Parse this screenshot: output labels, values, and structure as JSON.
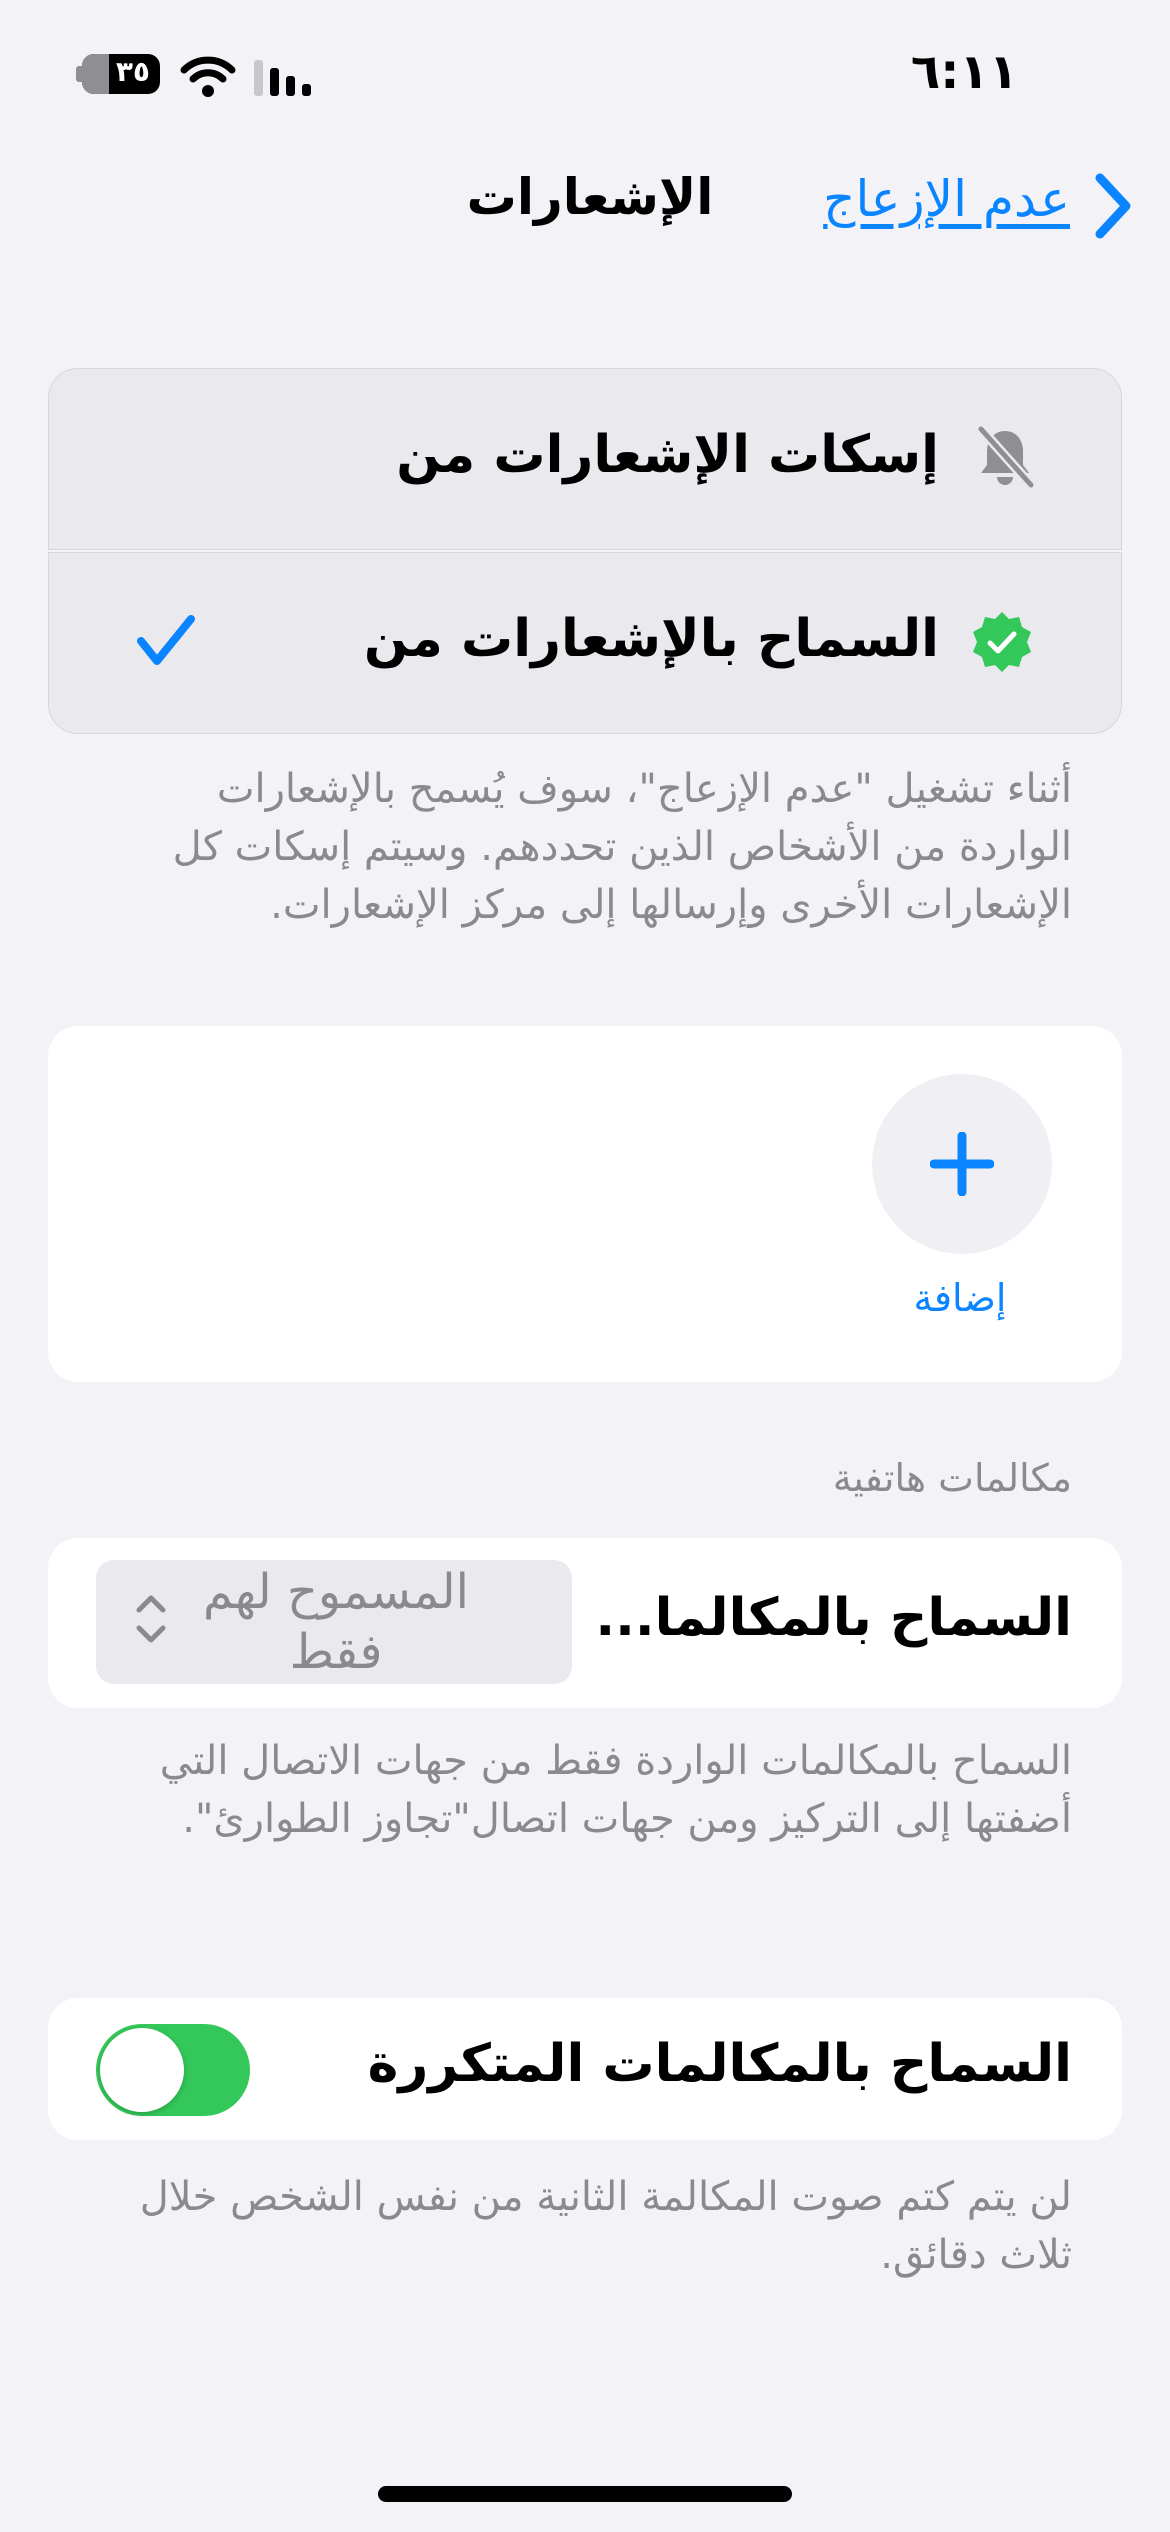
{
  "status_bar": {
    "time": "٦:١١",
    "battery": "٣٥",
    "battery_level": 0.35
  },
  "nav": {
    "back_label": "عدم الإزعاج",
    "title": "الإشعارات"
  },
  "options": {
    "silence_label": "إسكات الإشعارات من",
    "allow_label": "السماح بالإشعارات من",
    "selected": "allow"
  },
  "options_footer": "أثناء تشغيل \"عدم الإزعاج\"، سوف يُسمح بالإشعارات الواردة من الأشخاص الذين تحددهم. وسيتم إسكات كل الإشعارات الأخرى وإرسالها إلى مركز الإشعارات.",
  "people": {
    "add_label": "إضافة"
  },
  "calls": {
    "header": "مكالمات هاتفية",
    "allow_calls_label": "السماح بالمكالما...",
    "allow_calls_value": "المسموح لهم فقط",
    "allow_calls_footer": "السماح بالمكالمات الواردة فقط من جهات الاتصال التي أضفتها إلى التركيز ومن جهات اتصال\"تجاوز الطوارئ\".",
    "repeated_label": "السماح بالمكالمات المتكررة",
    "repeated_on": true,
    "repeated_footer": "لن يتم كتم صوت المكالمة الثانية من نفس الشخص خلال ثلاث دقائق."
  },
  "colors": {
    "accent": "#0a84ff",
    "toggle_on": "#34c759",
    "verified": "#34c759",
    "secondary_text": "#8a8a8e"
  }
}
